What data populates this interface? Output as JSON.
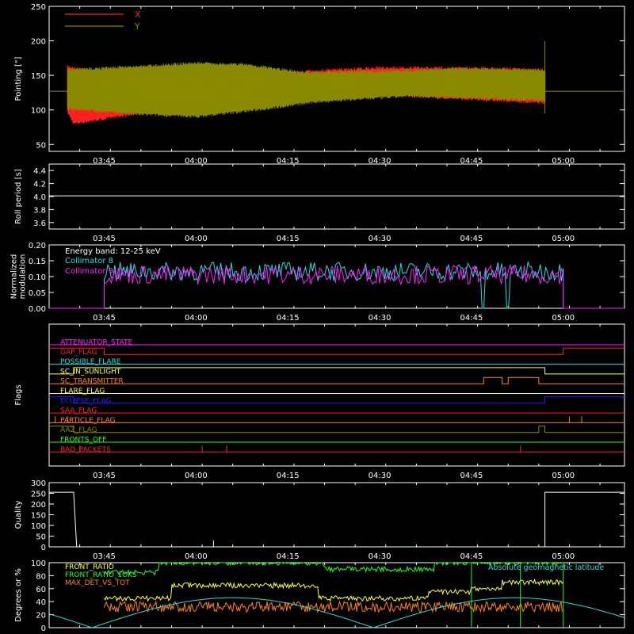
{
  "colors": {
    "background": "#000000",
    "axis": "#ffffff",
    "red": "#ff2020",
    "olive": "#8a8a00",
    "cyan": "#20e0e0",
    "magenta": "#ff20ff",
    "green": "#20ff20",
    "yellow": "#ffff40",
    "orange": "#ff8020",
    "blue": "#2020ff"
  },
  "time_ticks": [
    "03:45",
    "04:00",
    "04:15",
    "04:30",
    "04:45",
    "05:00"
  ],
  "chart_data": [
    {
      "type": "line",
      "panel": "pointing",
      "ylabel": "Pointing [\"]",
      "ylim": [
        40,
        250
      ],
      "y_ticks": [
        "50",
        "100",
        "150",
        "200",
        "250"
      ],
      "legend": [
        "X",
        "Y"
      ],
      "legend_position": "top-left",
      "time_range": [
        "03:36",
        "05:10"
      ],
      "baseline": 127,
      "series": [
        {
          "name": "X",
          "color": "#ff2020",
          "start": "03:39",
          "end": "04:57",
          "upper": [
            [
              "03:39",
              165
            ],
            [
              "03:50",
              148
            ],
            [
              "04:08",
              150
            ],
            [
              "04:18",
              158
            ],
            [
              "04:30",
              163
            ],
            [
              "04:45",
              163
            ],
            [
              "04:57",
              160
            ]
          ],
          "lower": [
            [
              "03:39",
              95
            ],
            [
              "03:40",
              78
            ],
            [
              "03:50",
              92
            ],
            [
              "04:00",
              100
            ],
            [
              "04:15",
              116
            ],
            [
              "04:30",
              120
            ],
            [
              "04:57",
              108
            ]
          ]
        },
        {
          "name": "Y",
          "color": "#8a8a00",
          "start": "03:39",
          "end": "04:57",
          "upper": [
            [
              "03:39",
              160
            ],
            [
              "03:50",
              165
            ],
            [
              "04:00",
              170
            ],
            [
              "04:08",
              168
            ],
            [
              "04:18",
              156
            ],
            [
              "04:30",
              158
            ],
            [
              "04:45",
              162
            ],
            [
              "04:57",
              160
            ]
          ],
          "lower": [
            [
              "03:39",
              100
            ],
            [
              "03:50",
              92
            ],
            [
              "04:00",
              88
            ],
            [
              "04:10",
              98
            ],
            [
              "04:20",
              110
            ],
            [
              "04:35",
              118
            ],
            [
              "04:57",
              112
            ]
          ]
        }
      ]
    },
    {
      "type": "line",
      "panel": "roll",
      "ylabel": "Roll period [s]",
      "ylim": [
        3.5,
        4.5
      ],
      "y_ticks": [
        "3.6",
        "3.8",
        "4.0",
        "4.2",
        "4.4"
      ],
      "series": [
        {
          "name": "",
          "color": "#ffffff",
          "value": 4.01
        }
      ]
    },
    {
      "type": "line",
      "panel": "modulation",
      "ylabel": "Normalized modulation",
      "ylim": [
        0,
        0.2
      ],
      "y_ticks": [
        "0.00",
        "0.05",
        "0.10",
        "0.15",
        "0.20"
      ],
      "annotation": "Energy band: 12-25 keV",
      "series": [
        {
          "name": "Collimator 8",
          "color": "#20e0e0",
          "mean": 0.11,
          "start": "03:45",
          "end": "05:00"
        },
        {
          "name": "Collimator 9",
          "color": "#ff20ff",
          "mean": 0.1,
          "start": "03:45",
          "end": "05:00"
        }
      ]
    },
    {
      "type": "table",
      "panel": "flags",
      "ylabel": "Flags",
      "series": [
        {
          "name": "ATTENUATOR_STATE",
          "color": "#ff20ff"
        },
        {
          "name": "GAP_FLAG",
          "color": "#ff2020"
        },
        {
          "name": "POSSIBLE_FLARE",
          "color": "#20e0e0"
        },
        {
          "name": "SC_IN_SUNLIGHT",
          "color": "#ffff40"
        },
        {
          "name": "SC_TRANSMITTER",
          "color": "#ff8020"
        },
        {
          "name": "FLARE_FLAG",
          "color": "#ffff40"
        },
        {
          "name": "ECLIPSE_FLAG",
          "color": "#2020ff"
        },
        {
          "name": "SAA_FLAG",
          "color": "#ff2020"
        },
        {
          "name": "PARTICLE_FLAG",
          "color": "#ff8020"
        },
        {
          "name": "AAZ_FLAG",
          "color": "#8a8a00"
        },
        {
          "name": "FRONTS_OFF",
          "color": "#20ff20"
        },
        {
          "name": "BAD_PACKETS",
          "color": "#ff2020"
        }
      ]
    },
    {
      "type": "line",
      "panel": "quality",
      "ylabel": "Quality",
      "ylim": [
        0,
        300
      ],
      "y_ticks": [
        "0",
        "50",
        "100",
        "150",
        "200",
        "250",
        "300"
      ],
      "series": [
        {
          "name": "",
          "color": "#ffffff"
        }
      ]
    },
    {
      "type": "line",
      "panel": "ratios",
      "ylabel": "Degrees or %",
      "ylim": [
        0,
        100
      ],
      "y_ticks": [
        "0",
        "20",
        "40",
        "60",
        "80",
        "100"
      ],
      "series": [
        {
          "name": "FRONT_RATIO",
          "color": "#ffff40"
        },
        {
          "name": "FRONT_RATIO_1OKS",
          "color": "#20ff20"
        },
        {
          "name": "MAX_DET_VS_TOT",
          "color": "#ff8020"
        },
        {
          "name": "Absolute geomagnetic latitude",
          "color": "#20e0e0"
        }
      ]
    }
  ]
}
